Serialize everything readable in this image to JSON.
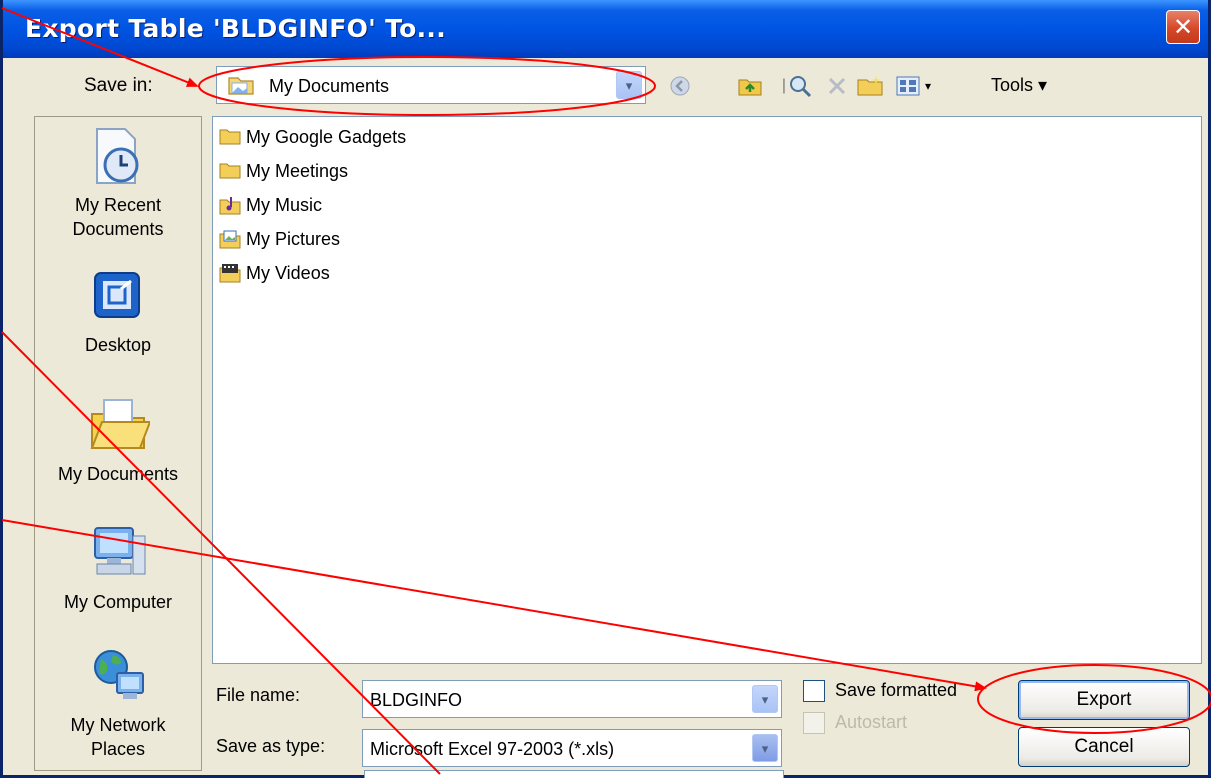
{
  "dialog": {
    "title": "Export Table 'BLDGINFO' To...",
    "close_glyph": "✕"
  },
  "save_in": {
    "label": "Save in:",
    "value": "My Documents",
    "arrow": "▾"
  },
  "toolbar": {
    "tools_label": "Tools ▾",
    "icons": [
      "back-icon",
      "up-folder-icon",
      "search-web-icon",
      "delete-icon",
      "new-folder-icon",
      "views-icon"
    ]
  },
  "places": [
    {
      "label_1": "My Recent",
      "label_2": "Documents",
      "icon": "recent-documents-icon"
    },
    {
      "label_1": "Desktop",
      "icon": "desktop-icon"
    },
    {
      "label_1": "My Documents",
      "icon": "my-documents-icon"
    },
    {
      "label_1": "My Computer",
      "icon": "my-computer-icon"
    },
    {
      "label_1": "My Network",
      "label_2": "Places",
      "icon": "network-places-icon"
    }
  ],
  "files": [
    {
      "name": "My Google Gadgets",
      "icon": "folder-icon"
    },
    {
      "name": "My Meetings",
      "icon": "folder-icon"
    },
    {
      "name": "My Music",
      "icon": "music-folder-icon"
    },
    {
      "name": "My Pictures",
      "icon": "pictures-folder-icon"
    },
    {
      "name": "My Videos",
      "icon": "videos-folder-icon"
    }
  ],
  "file_name": {
    "label": "File name:",
    "value": "BLDGINFO"
  },
  "save_as_type": {
    "label": "Save as type:",
    "value": "Microsoft Excel 97-2003 (*.xls)"
  },
  "options": {
    "save_formatted": "Save formatted",
    "autostart": "Autostart"
  },
  "buttons": {
    "export": "Export",
    "cancel": "Cancel"
  },
  "colors": {
    "annotation": "#ff0000",
    "title_bar": "#0054e3",
    "dialog_bg": "#ece9d8"
  }
}
